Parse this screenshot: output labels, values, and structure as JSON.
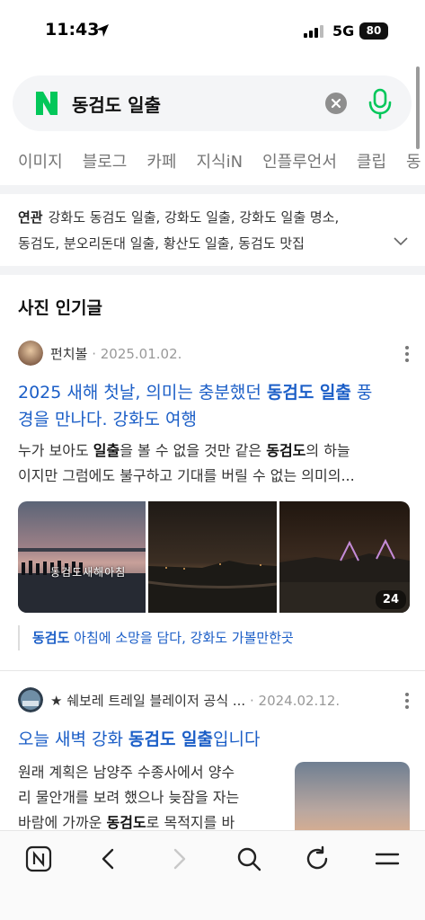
{
  "status": {
    "time": "11:43",
    "network": "5G",
    "battery": "80"
  },
  "search": {
    "logo": "N",
    "query": "동검도 일출"
  },
  "tabs": [
    "이미지",
    "블로그",
    "카페",
    "지식iN",
    "인플루언서",
    "클립",
    "동"
  ],
  "related": {
    "label": "연관",
    "line1": "강화도 동검도 일출, 강화도 일출, 강화도 일출 명소,",
    "line2": "동검도, 분오리돈대 일출, 황산도 일출, 동검도 맛집"
  },
  "section": {
    "title": "사진 인기글"
  },
  "post1": {
    "author": "펀치볼",
    "date": "2025.01.02.",
    "title_a": "2025 새해 첫날, 의미는 충분했던 ",
    "title_b": "동검도 일출",
    "title_c": " 풍",
    "title_line2": "경을 만나다. 강화도 여행",
    "desc1_a": "누가 보아도 ",
    "desc1_b": "일출",
    "desc1_c": "을 볼 수 없을 것만 같은 ",
    "desc1_d": "동검도",
    "desc1_e": "의 하늘",
    "desc2": "이지만 그럼에도 불구하고 기대를 버릴 수 없는 의미의...",
    "image_caption": "동검도새해아침",
    "image_count": "24",
    "sublink_a": "동검도",
    "sublink_b": " 아침에 소망을 담다, 강화도 가볼만한곳"
  },
  "post2": {
    "author": "★ 쉐보레 트레일 블레이저 공식 ...",
    "date": "2024.02.12.",
    "title_a": "오늘 새벽 강화 ",
    "title_b": "동검도 일출",
    "title_c": "입니다",
    "desc1": "원래 계획은 남양주 수종사에서 양수",
    "desc2": "리 물안개를 보려 했으나 늦잠을 자는",
    "desc3_a": "바람에 가까운 ",
    "desc3_b": "동검도",
    "desc3_c": "로 목적지를 바"
  },
  "colors": {
    "accent": "#1b5ec7",
    "naver_green": "#03c75a"
  },
  "icons": {
    "toolbar": [
      "naver-home-icon",
      "back-icon",
      "forward-icon",
      "search-icon",
      "refresh-icon",
      "menu-icon"
    ]
  }
}
